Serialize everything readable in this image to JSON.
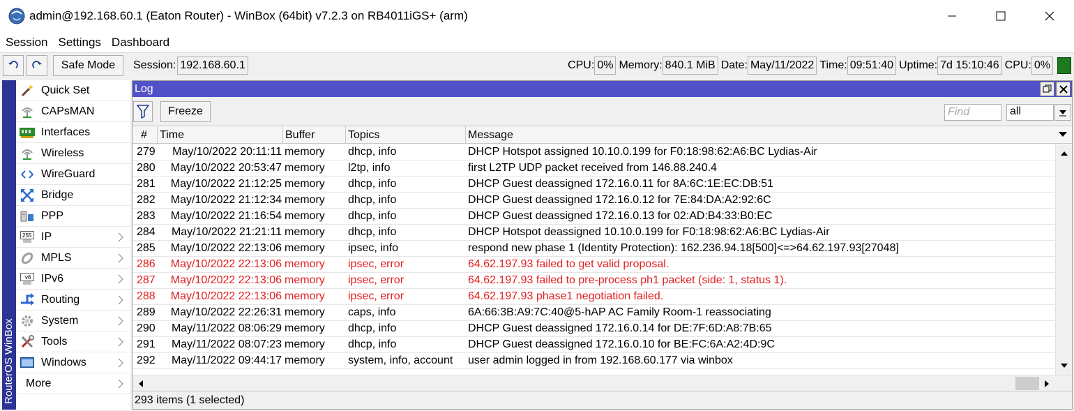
{
  "window": {
    "title": "admin@192.168.60.1 (Eaton Router) - WinBox (64bit) v7.2.3 on RB4011iGS+ (arm)"
  },
  "menu": [
    "Session",
    "Settings",
    "Dashboard"
  ],
  "toolbar": {
    "safe_mode_label": "Safe Mode",
    "session_label": "Session:",
    "session_value": "192.168.60.1",
    "cpu_label": "CPU:",
    "cpu_value": "0%",
    "memory_label": "Memory:",
    "memory_value": "840.1 MiB",
    "date_label": "Date:",
    "date_value": "May/11/2022",
    "time_label": "Time:",
    "time_value": "09:51:40",
    "uptime_label": "Uptime:",
    "uptime_value": "7d 15:10:46",
    "cpu2_label": "CPU:",
    "cpu2_value": "0%"
  },
  "brand_vertical": "RouterOS WinBox",
  "sidebar": {
    "items": [
      {
        "label": "Quick Set",
        "icon": "wand-icon",
        "submenu": false
      },
      {
        "label": "CAPsMAN",
        "icon": "antenna-icon",
        "submenu": false
      },
      {
        "label": "Interfaces",
        "icon": "network-card-icon",
        "submenu": false
      },
      {
        "label": "Wireless",
        "icon": "antenna-icon",
        "submenu": false
      },
      {
        "label": "WireGuard",
        "icon": "wireguard-icon",
        "submenu": false
      },
      {
        "label": "Bridge",
        "icon": "bridge-icon",
        "submenu": false
      },
      {
        "label": "PPP",
        "icon": "ppp-icon",
        "submenu": false
      },
      {
        "label": "IP",
        "icon": "ip-icon",
        "submenu": true
      },
      {
        "label": "MPLS",
        "icon": "mpls-icon",
        "submenu": true
      },
      {
        "label": "IPv6",
        "icon": "ipv6-icon",
        "submenu": true
      },
      {
        "label": "Routing",
        "icon": "routing-icon",
        "submenu": true
      },
      {
        "label": "System",
        "icon": "gear-icon",
        "submenu": true
      },
      {
        "label": "Tools",
        "icon": "tools-icon",
        "submenu": true
      },
      {
        "label": "Windows",
        "icon": "windows-icon",
        "submenu": true
      },
      {
        "label": "More",
        "icon": "",
        "submenu": true
      }
    ]
  },
  "log": {
    "title": "Log",
    "freeze_label": "Freeze",
    "find_placeholder": "Find",
    "filter_value": "all",
    "columns": [
      "#",
      "Time",
      "Buffer",
      "Topics",
      "Message"
    ],
    "rows": [
      {
        "num": "279",
        "time": "May/10/2022 20:11:11",
        "buffer": "memory",
        "topics": "dhcp, info",
        "message": "DHCP Hotspot assigned 10.10.0.199 for F0:18:98:62:A6:BC Lydias-Air",
        "error": false
      },
      {
        "num": "280",
        "time": "May/10/2022 20:53:47",
        "buffer": "memory",
        "topics": "l2tp, info",
        "message": "first L2TP UDP packet received from 146.88.240.4",
        "error": false
      },
      {
        "num": "281",
        "time": "May/10/2022 21:12:25",
        "buffer": "memory",
        "topics": "dhcp, info",
        "message": "DHCP Guest deassigned 172.16.0.11 for 8A:6C:1E:EC:DB:51",
        "error": false
      },
      {
        "num": "282",
        "time": "May/10/2022 21:12:34",
        "buffer": "memory",
        "topics": "dhcp, info",
        "message": "DHCP Guest deassigned 172.16.0.12 for 7E:84:DA:A2:92:6C",
        "error": false
      },
      {
        "num": "283",
        "time": "May/10/2022 21:16:54",
        "buffer": "memory",
        "topics": "dhcp, info",
        "message": "DHCP Guest deassigned 172.16.0.13 for 02:AD:B4:33:B0:EC",
        "error": false
      },
      {
        "num": "284",
        "time": "May/10/2022 21:21:11",
        "buffer": "memory",
        "topics": "dhcp, info",
        "message": "DHCP Hotspot deassigned 10.10.0.199 for F0:18:98:62:A6:BC Lydias-Air",
        "error": false
      },
      {
        "num": "285",
        "time": "May/10/2022 22:13:06",
        "buffer": "memory",
        "topics": "ipsec, info",
        "message": "respond new phase 1 (Identity Protection): 162.236.94.18[500]<=>64.62.197.93[27048]",
        "error": false
      },
      {
        "num": "286",
        "time": "May/10/2022 22:13:06",
        "buffer": "memory",
        "topics": "ipsec, error",
        "message": "64.62.197.93 failed to get valid proposal.",
        "error": true
      },
      {
        "num": "287",
        "time": "May/10/2022 22:13:06",
        "buffer": "memory",
        "topics": "ipsec, error",
        "message": "64.62.197.93 failed to pre-process ph1 packet (side: 1, status 1).",
        "error": true
      },
      {
        "num": "288",
        "time": "May/10/2022 22:13:06",
        "buffer": "memory",
        "topics": "ipsec, error",
        "message": "64.62.197.93 phase1 negotiation failed.",
        "error": true
      },
      {
        "num": "289",
        "time": "May/10/2022 22:26:31",
        "buffer": "memory",
        "topics": "caps, info",
        "message": "6A:66:3B:A9:7C:40@5-hAP AC Family Room-1 reassociating",
        "error": false
      },
      {
        "num": "290",
        "time": "May/11/2022 08:06:29",
        "buffer": "memory",
        "topics": "dhcp, info",
        "message": "DHCP Guest deassigned 172.16.0.14 for DE:7F:6D:A8:7B:65",
        "error": false
      },
      {
        "num": "291",
        "time": "May/11/2022 08:07:23",
        "buffer": "memory",
        "topics": "dhcp, info",
        "message": "DHCP Guest deassigned 172.16.0.10 for BE:FC:6A:A2:4D:9C",
        "error": false
      },
      {
        "num": "292",
        "time": "May/11/2022 09:44:17",
        "buffer": "memory",
        "topics": "system, info, account",
        "message": "user admin logged in from 192.168.60.177 via winbox",
        "error": false
      }
    ],
    "status": "293 items (1 selected)"
  },
  "colors": {
    "log_title_bg": "#5151c8",
    "brand_bar_bg": "#2c3494",
    "error_text": "#e02020",
    "cpu_indicator": "#1e7a1e"
  }
}
